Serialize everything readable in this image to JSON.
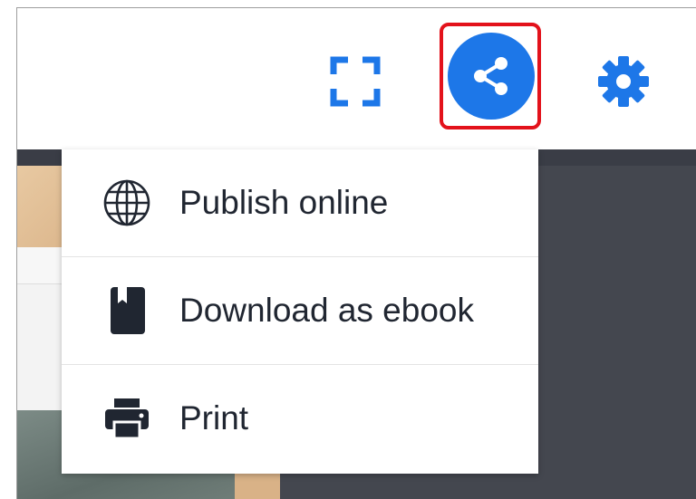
{
  "toolbar": {
    "icons": {
      "fullscreen": "fullscreen-icon",
      "share": "share-icon",
      "settings": "gear-icon"
    },
    "highlight_color": "#e3121b",
    "accent_color": "#1d77e8"
  },
  "share_menu": {
    "items": [
      {
        "label": "Publish online",
        "icon": "globe-icon"
      },
      {
        "label": "Download as ebook",
        "icon": "book-icon"
      },
      {
        "label": "Print",
        "icon": "printer-icon"
      }
    ]
  }
}
